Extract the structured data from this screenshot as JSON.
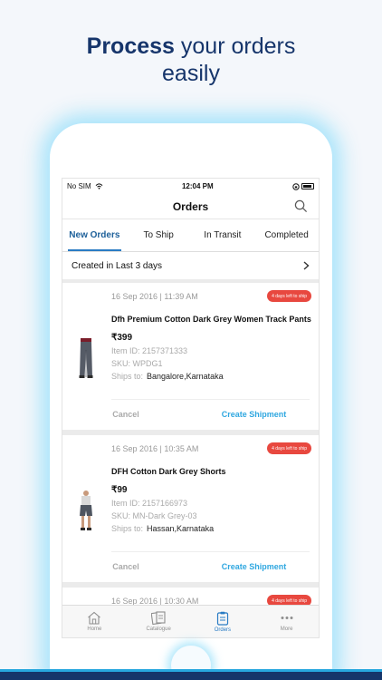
{
  "headline": {
    "bold": "Process",
    "rest": " your orders",
    "line2": "easily"
  },
  "status_bar": {
    "carrier": "No SIM",
    "time": "12:04 PM"
  },
  "nav": {
    "title": "Orders"
  },
  "tabs": [
    {
      "label": "New Orders",
      "active": true
    },
    {
      "label": "To Ship",
      "active": false
    },
    {
      "label": "In Transit",
      "active": false
    },
    {
      "label": "Completed",
      "active": false
    }
  ],
  "filter": {
    "label": "Created in Last 3 days"
  },
  "orders": [
    {
      "date": "16 Sep 2016 | 11:39 AM",
      "badge": "4 days left to ship",
      "name": "Dfh Premium Cotton Dark Grey Women Track Pants",
      "price": "₹399",
      "item_id": "Item ID: 2157371333",
      "sku": "SKU: WPDG1",
      "ships_label": "Ships to:",
      "ships_value": "Bangalore,Karnataka",
      "cancel": "Cancel",
      "create": "Create Shipment"
    },
    {
      "date": "16 Sep 2016 | 10:35 AM",
      "badge": "4 days left to ship",
      "name": "DFH Cotton Dark Grey Shorts",
      "price": "₹99",
      "item_id": "Item ID: 2157166973",
      "sku": "SKU: MN-Dark Grey-03",
      "ships_label": "Ships to:",
      "ships_value": "Hassan,Karnataka",
      "cancel": "Cancel",
      "create": "Create Shipment"
    },
    {
      "date": "16 Sep 2016 | 10:30 AM",
      "badge": "4 days left to ship"
    }
  ],
  "tab_bar": [
    {
      "label": "Home",
      "icon": "home-icon"
    },
    {
      "label": "Catalogue",
      "icon": "catalogue-icon"
    },
    {
      "label": "Orders",
      "icon": "orders-icon",
      "active": true
    },
    {
      "label": "More",
      "icon": "more-icon"
    }
  ],
  "colors": {
    "brand": "#16356b",
    "accent": "#2fa7e0",
    "badge": "#e8483f",
    "active_tab": "#2a7cc4"
  }
}
